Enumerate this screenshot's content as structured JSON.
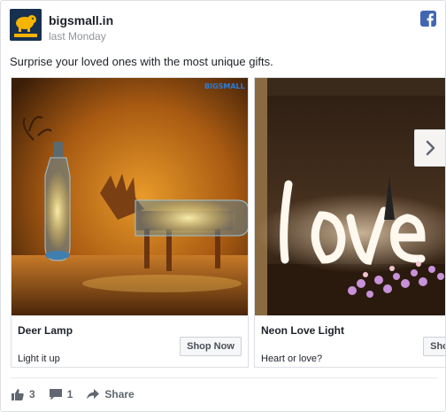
{
  "page": {
    "name": "bigsmall.in",
    "time": "last Monday"
  },
  "icons": {
    "avatar": "bigsmall-logo",
    "network": "facebook-icon",
    "next": "chevron-right-icon",
    "like": "thumbs-up-icon",
    "comment": "comment-icon",
    "share": "share-arrow-icon"
  },
  "caption": "Surprise your loved ones with the most unique gifts.",
  "cards": [
    {
      "title": "Deer Lamp",
      "description": "Light it up",
      "button": "Shop Now",
      "watermark": "BIGSMALL"
    },
    {
      "title": "Neon Love Light",
      "description": "Heart or love?",
      "button": "Shop Now"
    }
  ],
  "stats": {
    "likes": "3",
    "comments": "1",
    "share_label": "Share"
  },
  "colors": {
    "facebook_blue": "#4267b2",
    "text_secondary": "#90949c"
  }
}
